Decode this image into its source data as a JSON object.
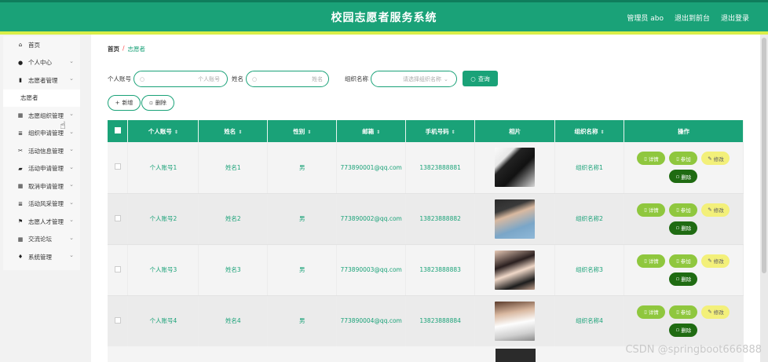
{
  "header": {
    "title": "校园志愿者服务系统",
    "admin_label": "管理员 abo",
    "back_label": "退出到前台",
    "logout_label": "退出登录"
  },
  "sidebar": {
    "items": [
      {
        "label": "首页",
        "icon": "home-icon",
        "has_children": false
      },
      {
        "label": "个人中心",
        "icon": "user-icon",
        "has_children": true
      },
      {
        "label": "志愿者管理",
        "icon": "clipboard-icon",
        "has_children": true
      },
      {
        "label": "志愿者",
        "icon": "",
        "has_children": false,
        "sub": true
      },
      {
        "label": "志愿组织管理",
        "icon": "grid-icon",
        "has_children": true
      },
      {
        "label": "组织申请管理",
        "icon": "list-icon",
        "has_children": true
      },
      {
        "label": "活动信息管理",
        "icon": "ticket-icon",
        "has_children": true
      },
      {
        "label": "活动申请管理",
        "icon": "folder-icon",
        "has_children": true
      },
      {
        "label": "取消申请管理",
        "icon": "grid-icon",
        "has_children": true
      },
      {
        "label": "活动风采管理",
        "icon": "list-icon",
        "has_children": true
      },
      {
        "label": "志愿人才管理",
        "icon": "flag-icon",
        "has_children": true
      },
      {
        "label": "交流论坛",
        "icon": "grid-icon",
        "has_children": true
      },
      {
        "label": "系统管理",
        "icon": "pin-icon",
        "has_children": true
      }
    ]
  },
  "breadcrumb": {
    "home": "首页",
    "separator": "/",
    "current": "志愿者"
  },
  "search": {
    "account_label": "个人账号",
    "account_placeholder": "个人账号",
    "name_label": "姓名",
    "name_placeholder": "姓名",
    "org_label": "组织名称",
    "org_placeholder": "请选择组织名称",
    "query_label": "查询"
  },
  "actions": {
    "add_label": "新增",
    "delete_label": "删除"
  },
  "table": {
    "columns": [
      "个人账号",
      "姓名",
      "性别",
      "邮箱",
      "手机号码",
      "相片",
      "组织名称",
      "操作"
    ],
    "rows": [
      {
        "account": "个人账号1",
        "name": "姓名1",
        "gender": "男",
        "email": "773890001@qq.com",
        "phone": "13823888881",
        "org": "组织名称1"
      },
      {
        "account": "个人账号2",
        "name": "姓名2",
        "gender": "男",
        "email": "773890002@qq.com",
        "phone": "13823888882",
        "org": "组织名称2"
      },
      {
        "account": "个人账号3",
        "name": "姓名3",
        "gender": "男",
        "email": "773890003@qq.com",
        "phone": "13823888883",
        "org": "组织名称3"
      },
      {
        "account": "个人账号4",
        "name": "姓名4",
        "gender": "男",
        "email": "773890004@qq.com",
        "phone": "13823888884",
        "org": "组织名称4"
      }
    ],
    "ops": {
      "detail": "详情",
      "join": "参加",
      "edit": "修改",
      "delete": "删除"
    }
  },
  "watermark": "CSDN @springboot666888",
  "colors": {
    "primary": "#1aa278",
    "accent_bar": "#d9ee48",
    "op_green": "#8fc73e",
    "op_yellow": "#f3f07a",
    "op_dark": "#1f6b12"
  }
}
